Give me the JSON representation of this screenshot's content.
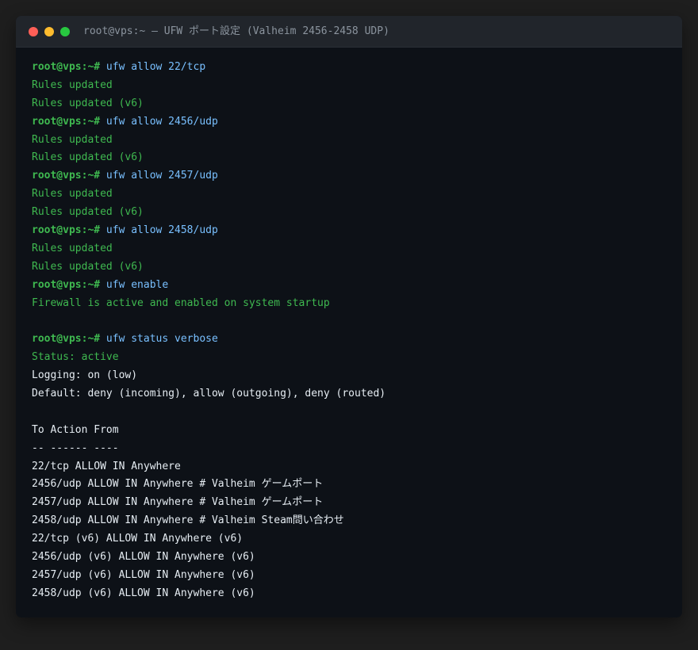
{
  "window": {
    "title": "root@vps:~ — UFW ポート設定 (Valheim 2456-2458 UDP)"
  },
  "colors": {
    "prompt": "#3fb950",
    "command": "#79c0ff",
    "output_success": "#3fb950",
    "output_plain": "#e6edf3",
    "background": "#0d1117"
  },
  "terminal": {
    "lines": [
      {
        "type": "cmd",
        "prompt": "root@vps:~#",
        "text": " ufw allow 22/tcp"
      },
      {
        "type": "ok",
        "text": "Rules updated"
      },
      {
        "type": "ok",
        "text": "Rules updated (v6)"
      },
      {
        "type": "cmd",
        "prompt": "root@vps:~#",
        "text": " ufw allow 2456/udp"
      },
      {
        "type": "ok",
        "text": "Rules updated"
      },
      {
        "type": "ok",
        "text": "Rules updated (v6)"
      },
      {
        "type": "cmd",
        "prompt": "root@vps:~#",
        "text": " ufw allow 2457/udp"
      },
      {
        "type": "ok",
        "text": "Rules updated"
      },
      {
        "type": "ok",
        "text": "Rules updated (v6)"
      },
      {
        "type": "cmd",
        "prompt": "root@vps:~#",
        "text": " ufw allow 2458/udp"
      },
      {
        "type": "ok",
        "text": "Rules updated"
      },
      {
        "type": "ok",
        "text": "Rules updated (v6)"
      },
      {
        "type": "cmd",
        "prompt": "root@vps:~#",
        "text": " ufw enable"
      },
      {
        "type": "ok",
        "text": "Firewall is active and enabled on system startup"
      },
      {
        "type": "blank",
        "text": ""
      },
      {
        "type": "cmd",
        "prompt": "root@vps:~#",
        "text": " ufw status verbose"
      },
      {
        "type": "ok",
        "text": "Status: active"
      },
      {
        "type": "plain",
        "text": "Logging: on (low)"
      },
      {
        "type": "plain",
        "text": "Default: deny (incoming), allow (outgoing), deny (routed)"
      },
      {
        "type": "blank",
        "text": ""
      },
      {
        "type": "plain",
        "text": "To Action From"
      },
      {
        "type": "plain",
        "text": "-- ------ ----"
      },
      {
        "type": "plain",
        "text": "22/tcp ALLOW IN Anywhere"
      },
      {
        "type": "plain",
        "text": "2456/udp ALLOW IN Anywhere # Valheim ゲームポート"
      },
      {
        "type": "plain",
        "text": "2457/udp ALLOW IN Anywhere # Valheim ゲームポート"
      },
      {
        "type": "plain",
        "text": "2458/udp ALLOW IN Anywhere # Valheim Steam問い合わせ"
      },
      {
        "type": "plain",
        "text": "22/tcp (v6) ALLOW IN Anywhere (v6)"
      },
      {
        "type": "plain",
        "text": "2456/udp (v6) ALLOW IN Anywhere (v6)"
      },
      {
        "type": "plain",
        "text": "2457/udp (v6) ALLOW IN Anywhere (v6)"
      },
      {
        "type": "plain",
        "text": "2458/udp (v6) ALLOW IN Anywhere (v6)"
      }
    ]
  }
}
